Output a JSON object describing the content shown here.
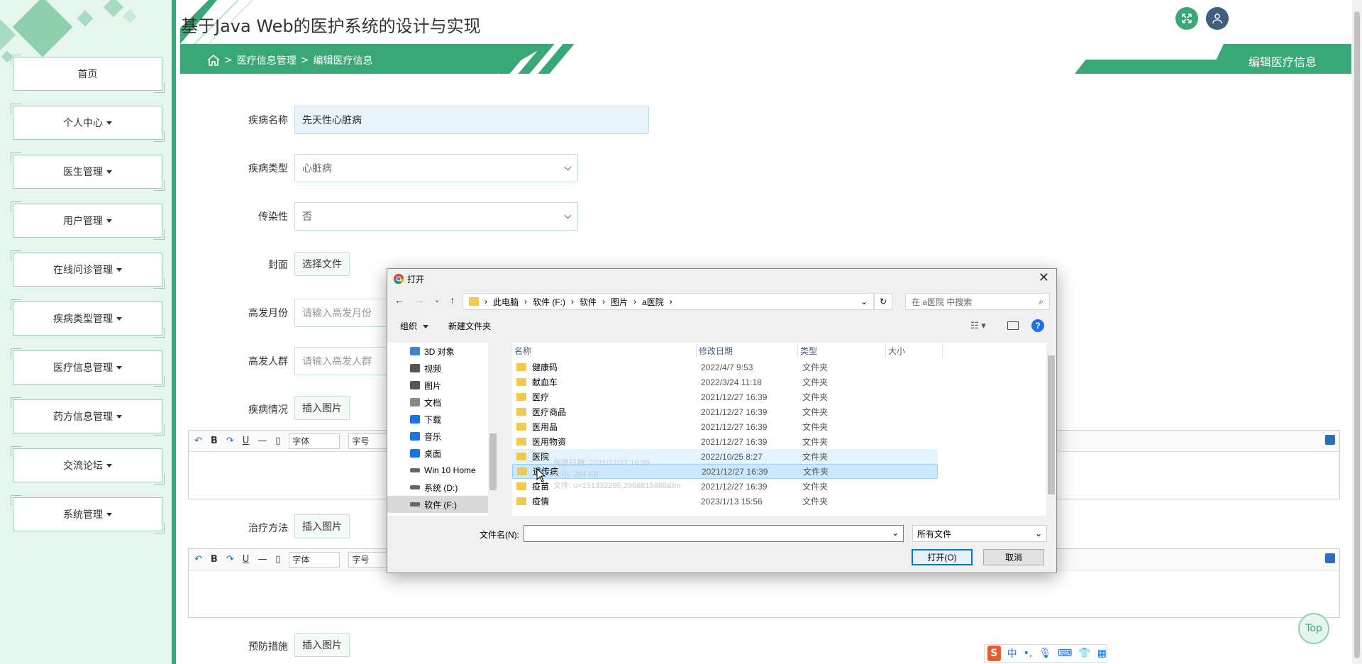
{
  "app": {
    "title": "基于Java Web的医护系统的设计与实现"
  },
  "sidebar": {
    "items": [
      {
        "label": "首页",
        "has_caret": false
      },
      {
        "label": "个人中心",
        "has_caret": true
      },
      {
        "label": "医生管理",
        "has_caret": true
      },
      {
        "label": "用户管理",
        "has_caret": true
      },
      {
        "label": "在线问诊管理",
        "has_caret": true
      },
      {
        "label": "疾病类型管理",
        "has_caret": true
      },
      {
        "label": "医疗信息管理",
        "has_caret": true
      },
      {
        "label": "药方信息管理",
        "has_caret": true
      },
      {
        "label": "交流论坛",
        "has_caret": true
      },
      {
        "label": "系统管理",
        "has_caret": true
      }
    ]
  },
  "breadcrumb": {
    "items": [
      "医疗信息管理",
      "编辑医疗信息"
    ],
    "separator": ">"
  },
  "right_tab": "编辑医疗信息",
  "form": {
    "disease_name_label": "疾病名称",
    "disease_name_value": "先天性心脏病",
    "disease_type_label": "疾病类型",
    "disease_type_value": "心脏病",
    "infectious_label": "传染性",
    "infectious_value": "否",
    "cover_label": "封面",
    "cover_button": "选择文件",
    "onset_month_label": "高发月份",
    "onset_month_placeholder": "请输入高发月份",
    "onset_group_label": "高发人群",
    "onset_group_placeholder": "请输入高发人群",
    "condition_label": "疾病情况",
    "treatment_label": "治疗方法",
    "prevention_label": "预防措施",
    "insert_image": "插入图片"
  },
  "editor_toolbar": {
    "bold": "B",
    "underline": "U",
    "font": "字体",
    "size": "字号"
  },
  "dialog": {
    "title": "打开",
    "path": [
      "此电脑",
      "软件 (F:)",
      "软件",
      "图片",
      "a医院"
    ],
    "search_placeholder": "在 a医院 中搜索",
    "organize": "组织",
    "new_folder": "新建文件夹",
    "tree": [
      {
        "label": "3D 对象",
        "color": "#3a86d4"
      },
      {
        "label": "视频",
        "color": "#555555"
      },
      {
        "label": "图片",
        "color": "#555555"
      },
      {
        "label": "文档",
        "color": "#888888"
      },
      {
        "label": "下载",
        "color": "#1a73e8"
      },
      {
        "label": "音乐",
        "color": "#1a73e8"
      },
      {
        "label": "桌面",
        "color": "#1a73e8"
      },
      {
        "label": "Win 10 Home",
        "color": "#666666"
      },
      {
        "label": "系统 (D:)",
        "color": "#666666"
      },
      {
        "label": "软件 (F:)",
        "color": "#666666"
      }
    ],
    "columns": {
      "name": "名称",
      "date": "修改日期",
      "type": "类型",
      "size": "大小"
    },
    "files": [
      {
        "name": "健康码",
        "date": "2022/4/7 9:53",
        "type": "文件夹"
      },
      {
        "name": "献血车",
        "date": "2022/3/24 11:18",
        "type": "文件夹"
      },
      {
        "name": "医疗",
        "date": "2021/12/27 16:39",
        "type": "文件夹"
      },
      {
        "name": "医疗商品",
        "date": "2021/12/27 16:39",
        "type": "文件夹"
      },
      {
        "name": "医用品",
        "date": "2021/12/27 16:39",
        "type": "文件夹"
      },
      {
        "name": "医用物资",
        "date": "2021/12/27 16:39",
        "type": "文件夹"
      },
      {
        "name": "医院",
        "date": "2022/10/25 8:27",
        "type": "文件夹"
      },
      {
        "name": "遗传病",
        "date": "2021/12/27 16:39",
        "type": "文件夹"
      },
      {
        "name": "疫苗",
        "date": "2021/12/27 16:39",
        "type": "文件夹"
      },
      {
        "name": "疫情",
        "date": "2023/1/13 15:56",
        "type": "文件夹"
      }
    ],
    "tooltip": [
      "创建日期: 2021/12/27 16:39",
      "大小: 264 KB",
      "文件: u=151332295,2968815888&fm"
    ],
    "filename_label": "文件名(N):",
    "filetype": "所有文件",
    "open_button": "打开(O)",
    "cancel_button": "取消"
  },
  "top_button": "Top",
  "ime": {
    "lang": "中",
    "punct": "•,"
  }
}
